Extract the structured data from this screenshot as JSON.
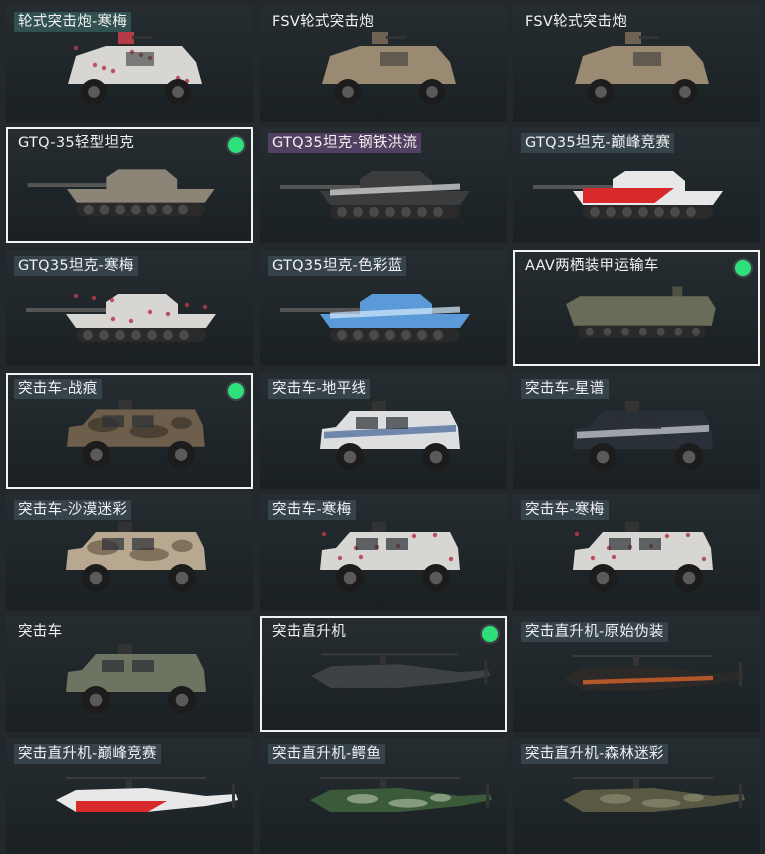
{
  "colors": {
    "background": "#22282b",
    "card": "#1f2629",
    "selected_border": "#f2f2f2",
    "equipped_dot": "#2ee07a",
    "label_text": "#f2f2f2"
  },
  "vehicles": [
    {
      "label": "轮式突击炮-寒梅",
      "type": "wheeled-gun",
      "primary": "#d8d6d2",
      "secondary": "#b63a48",
      "pattern": "blossom",
      "tag": "teal",
      "selected": false,
      "equipped": false
    },
    {
      "label": "FSV轮式突击炮",
      "type": "wheeled-gun",
      "primary": "#9a8a72",
      "secondary": "#6e6252",
      "pattern": "plain",
      "tag": "none",
      "selected": false,
      "equipped": false
    },
    {
      "label": "FSV轮式突击炮",
      "type": "wheeled-gun",
      "primary": "#9a8a72",
      "secondary": "#6e6252",
      "pattern": "plain",
      "tag": "none",
      "selected": false,
      "equipped": false
    },
    {
      "label": "GTQ-35轻型坦克",
      "type": "tank",
      "primary": "#8c8476",
      "secondary": "#6a6358",
      "pattern": "plain",
      "tag": "none",
      "selected": true,
      "equipped": true
    },
    {
      "label": "GTQ35坦克-钢铁洪流",
      "type": "tank",
      "primary": "#3a3c3e",
      "secondary": "#d8d8d8",
      "pattern": "stripe",
      "tag": "violet",
      "selected": false,
      "equipped": false
    },
    {
      "label": "GTQ35坦克-巅峰竞赛",
      "type": "tank",
      "primary": "#e8e8e8",
      "secondary": "#d82a2a",
      "pattern": "race",
      "tag": "slate",
      "selected": false,
      "equipped": false
    },
    {
      "label": "GTQ35坦克-寒梅",
      "type": "tank",
      "primary": "#d8d6d2",
      "secondary": "#b63a48",
      "pattern": "blossom",
      "tag": "slate",
      "selected": false,
      "equipped": false
    },
    {
      "label": "GTQ35坦克-色彩蓝",
      "type": "tank",
      "primary": "#5a9ad8",
      "secondary": "#cfe6fa",
      "pattern": "stripe",
      "tag": "slate",
      "selected": false,
      "equipped": false
    },
    {
      "label": "AAV两栖装甲运输车",
      "type": "amphibious",
      "primary": "#6a6c5a",
      "secondary": "#4e5042",
      "pattern": "plain",
      "tag": "none",
      "selected": true,
      "equipped": true
    },
    {
      "label": "突击车-战痕",
      "type": "assault-car",
      "primary": "#6e5e4c",
      "secondary": "#3a332a",
      "pattern": "camo",
      "tag": "slate",
      "selected": true,
      "equipped": true
    },
    {
      "label": "突击车-地平线",
      "type": "assault-car",
      "primary": "#dcdedf",
      "secondary": "#4a6a9a",
      "pattern": "stripe",
      "tag": "slate",
      "selected": false,
      "equipped": false
    },
    {
      "label": "突击车-星谱",
      "type": "assault-car",
      "primary": "#2a3038",
      "secondary": "#c8cad0",
      "pattern": "stripe",
      "tag": "slate",
      "selected": false,
      "equipped": false
    },
    {
      "label": "突击车-沙漠迷彩",
      "type": "assault-car",
      "primary": "#b8a890",
      "secondary": "#6a5a46",
      "pattern": "camo",
      "tag": "slate",
      "selected": false,
      "equipped": false
    },
    {
      "label": "突击车-寒梅",
      "type": "assault-car",
      "primary": "#d8d6d2",
      "secondary": "#b63a48",
      "pattern": "blossom",
      "tag": "slate",
      "selected": false,
      "equipped": false
    },
    {
      "label": "突击车-寒梅",
      "type": "assault-car",
      "primary": "#d8d6d2",
      "secondary": "#b63a48",
      "pattern": "blossom",
      "tag": "slate",
      "selected": false,
      "equipped": false
    },
    {
      "label": "突击车",
      "type": "assault-car",
      "primary": "#6e7462",
      "secondary": "#4a4f40",
      "pattern": "plain",
      "tag": "none",
      "selected": false,
      "equipped": false
    },
    {
      "label": "突击直升机",
      "type": "helicopter",
      "primary": "#3e4246",
      "secondary": "#2a2d30",
      "pattern": "plain",
      "tag": "none",
      "selected": true,
      "equipped": true
    },
    {
      "label": "突击直升机-原始伪装",
      "type": "helicopter",
      "primary": "#2c2a28",
      "secondary": "#e0662a",
      "pattern": "stripe",
      "tag": "slate",
      "selected": false,
      "equipped": false
    },
    {
      "label": "突击直升机-巅峰竞赛",
      "type": "helicopter",
      "primary": "#e8e8e8",
      "secondary": "#d82a2a",
      "pattern": "race",
      "tag": "slate",
      "selected": false,
      "equipped": false
    },
    {
      "label": "突击直升机-鳄鱼",
      "type": "helicopter",
      "primary": "#3a5a3a",
      "secondary": "#a8b898",
      "pattern": "camo",
      "tag": "slate",
      "selected": false,
      "equipped": false
    },
    {
      "label": "突击直升机-森林迷彩",
      "type": "helicopter",
      "primary": "#5a5a44",
      "secondary": "#8a8a70",
      "pattern": "camo",
      "tag": "slate",
      "selected": false,
      "equipped": false
    }
  ]
}
